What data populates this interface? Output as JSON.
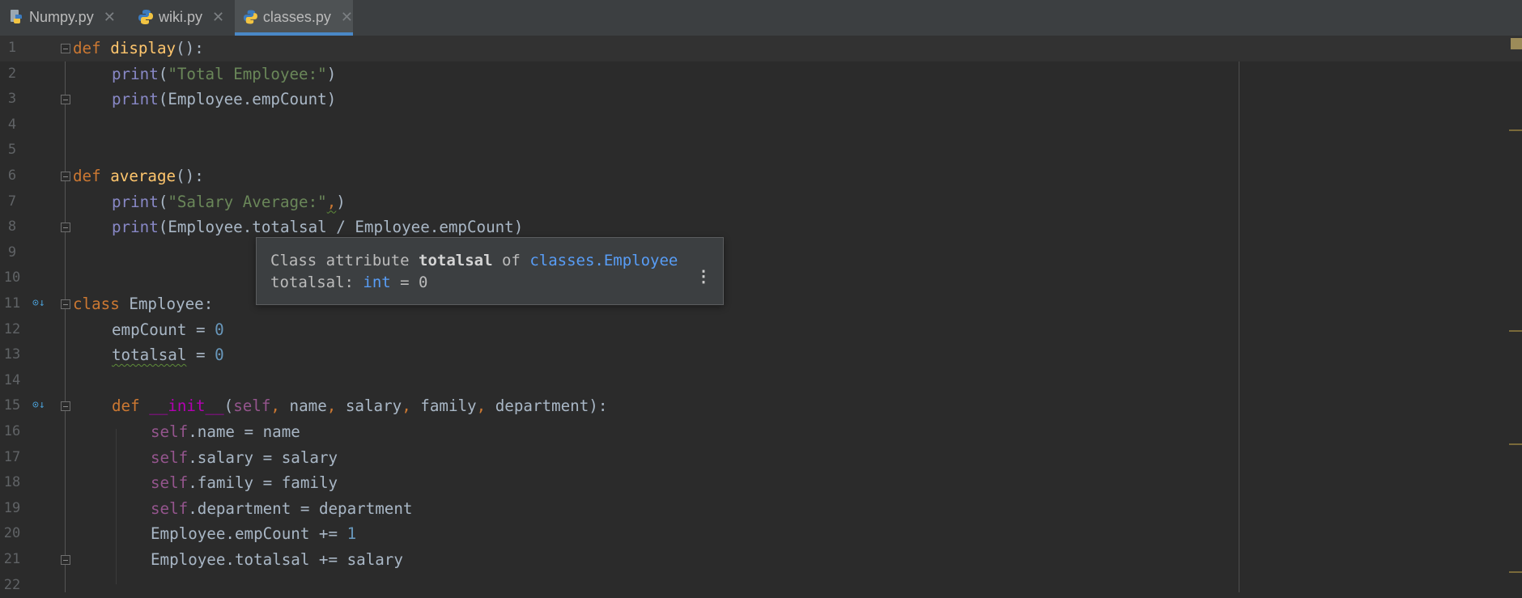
{
  "tabs": [
    {
      "label": "Numpy.py",
      "active": false
    },
    {
      "label": "wiki.py",
      "active": false
    },
    {
      "label": "classes.py",
      "active": true
    }
  ],
  "line_numbers": [
    "1",
    "2",
    "3",
    "4",
    "5",
    "6",
    "7",
    "8",
    "9",
    "10",
    "11",
    "12",
    "13",
    "14",
    "15",
    "16",
    "17",
    "18",
    "19",
    "20",
    "21",
    "22"
  ],
  "code": {
    "l1": {
      "kw": "def",
      "fn": "display",
      "rest": "():"
    },
    "l2": {
      "bi": "print",
      "open": "(",
      "str": "\"Total Employee:\"",
      "close": ")"
    },
    "l3": {
      "bi": "print",
      "rest": "(Employee.empCount)"
    },
    "l6": {
      "kw": "def",
      "fn": "average",
      "rest": "():"
    },
    "l7": {
      "bi": "print",
      "open": "(",
      "str": "\"Salary Average:\"",
      "comma": ",",
      "close": ")"
    },
    "l8": {
      "bi": "print",
      "rest": "(Employee.totalsal / Employee.empCount)"
    },
    "l11": {
      "kw": "class",
      "rest": " Employee:"
    },
    "l12": {
      "name": "empCount",
      "op": " = ",
      "num": "0"
    },
    "l13": {
      "name": "totalsal",
      "op": " = ",
      "num": "0"
    },
    "l15": {
      "kw": "def",
      "dnd": "__init__",
      "open": "(",
      "self": "self",
      "c1": ",",
      "p1": " name",
      "c2": ",",
      "p2": " salary",
      "c3": ",",
      "p3": " family",
      "c4": ",",
      "p4": " department",
      "close": "):"
    },
    "l16": {
      "self": "self",
      "rest": ".name = name"
    },
    "l17": {
      "self": "self",
      "rest": ".salary = salary"
    },
    "l18": {
      "self": "self",
      "rest": ".family = family"
    },
    "l19": {
      "self": "self",
      "rest": ".department = department"
    },
    "l20": {
      "rest": "Employee.empCount += ",
      "num": "1"
    },
    "l21": {
      "rest": "Employee.totalsal += salary"
    }
  },
  "popup": {
    "prefix": "Class attribute ",
    "attr": "totalsal",
    "of": " of ",
    "link": "classes.Employee",
    "sig_name": "totalsal: ",
    "sig_type": "int",
    "sig_value": " = 0"
  },
  "colors": {
    "background": "#2b2b2b",
    "keyword": "#cc7832",
    "function": "#ffc66d",
    "string": "#6a8759",
    "number": "#6897bb",
    "self": "#94558d",
    "link": "#589df6"
  },
  "icons": {
    "python_file": "python-file-icon",
    "close_tab": "close-icon",
    "override": "override-icon",
    "fold": "fold-icon",
    "more": "more-vertical-icon"
  }
}
